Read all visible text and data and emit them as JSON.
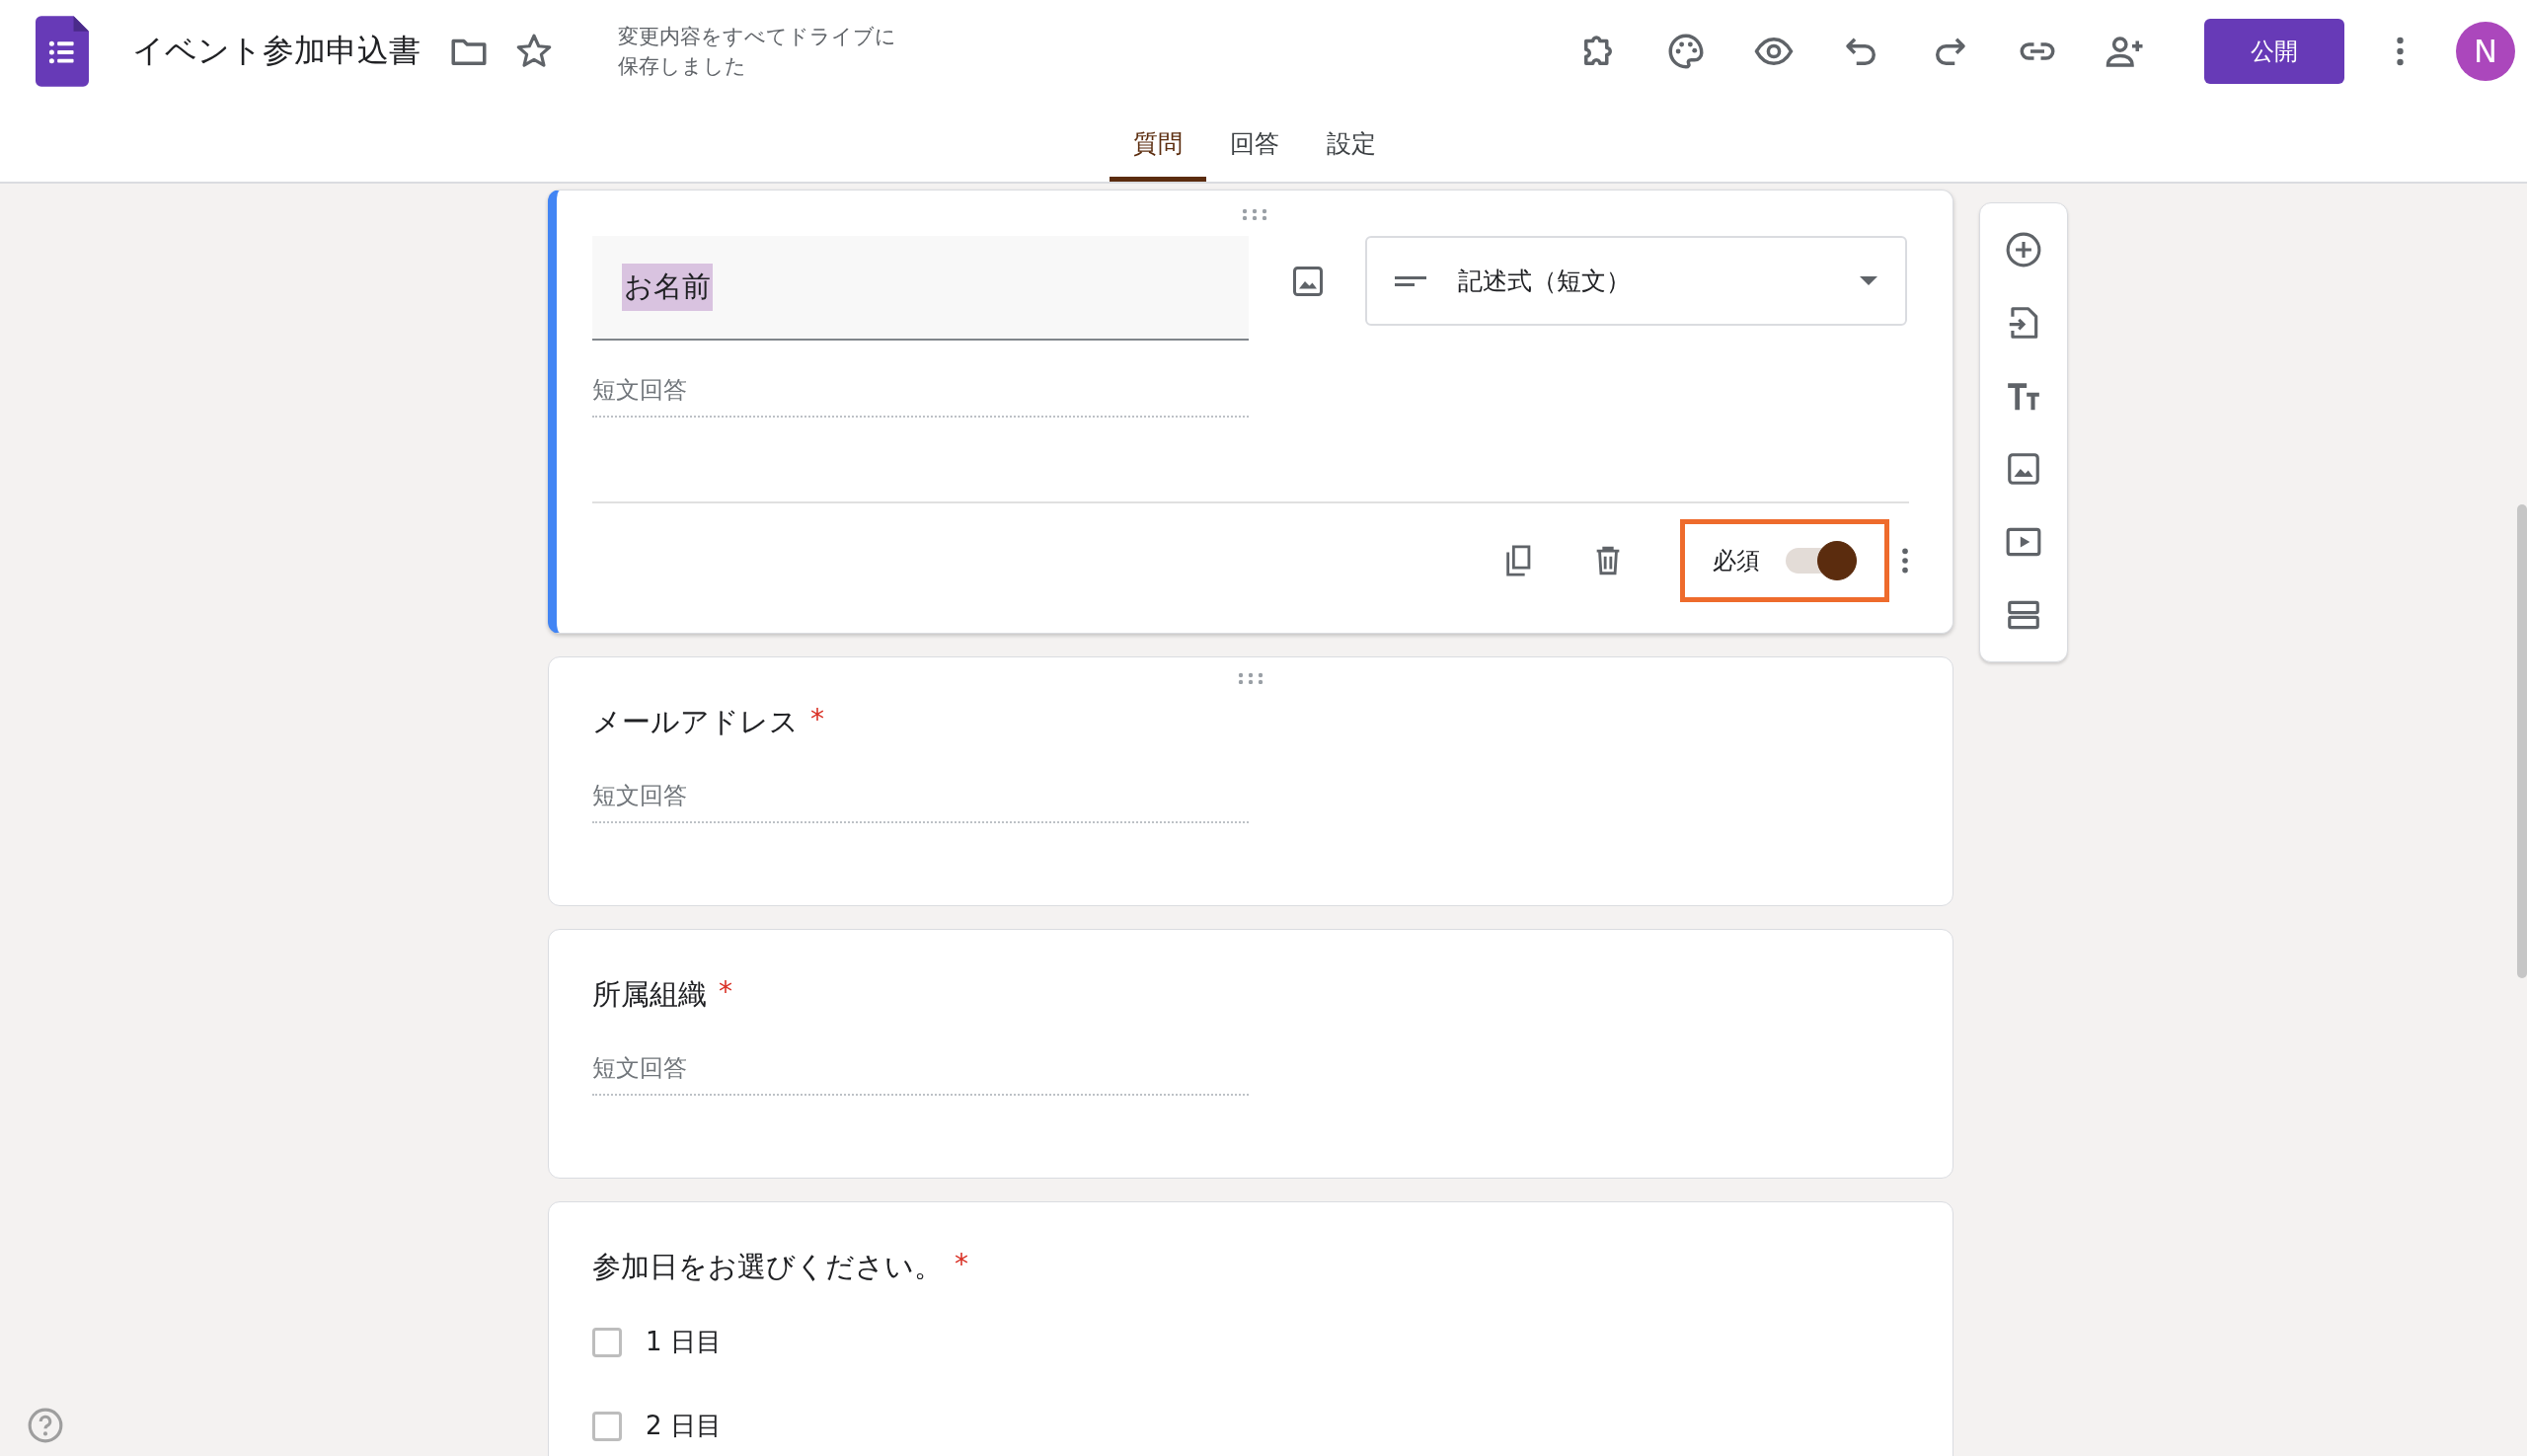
{
  "header": {
    "title": "イベント参加申込書",
    "save_status": "変更内容をすべてドライブに保存しました",
    "publish_button": "公開",
    "avatar": "N"
  },
  "tabs": [
    {
      "label": "質問",
      "selected": true
    },
    {
      "label": "回答",
      "selected": false
    },
    {
      "label": "設定",
      "selected": false
    }
  ],
  "questions": [
    {
      "kind": "editing",
      "title": "お名前",
      "title_selected": true,
      "placeholder": "短文回答",
      "type_label": "記述式（短文）",
      "required_label": "必須",
      "required": true,
      "highlighted": true
    },
    {
      "kind": "short",
      "title": "メールアドレス",
      "required_mark": "*",
      "placeholder": "短文回答",
      "drag_handle": true
    },
    {
      "kind": "short",
      "title": "所属組織",
      "required_mark": "*",
      "placeholder": "短文回答",
      "drag_handle": false
    },
    {
      "kind": "checkbox",
      "title": "参加日をお選びください。",
      "required_mark": "*",
      "options": [
        {
          "label": "1 日目",
          "checked": false
        },
        {
          "label": "2 日目",
          "checked": false
        }
      ]
    }
  ]
}
